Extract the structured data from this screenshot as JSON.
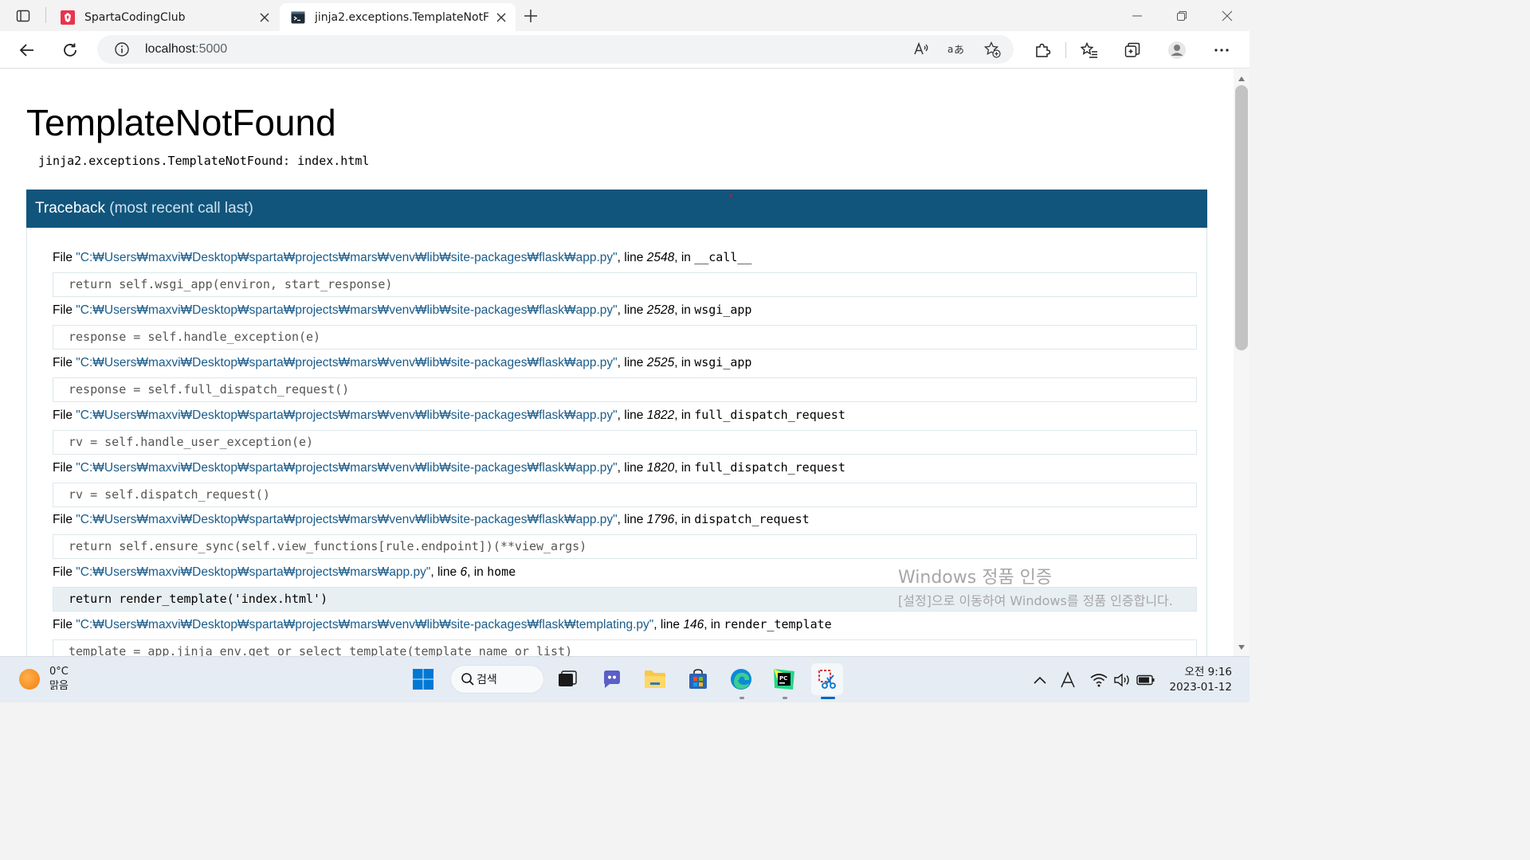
{
  "browser": {
    "tabs": [
      {
        "title": "SpartaCodingClub",
        "active": false
      },
      {
        "title": "jinja2.exceptions.TemplateNotFound",
        "active": true
      }
    ],
    "address": {
      "host": "localhost",
      "port": ":5000"
    }
  },
  "page": {
    "error_title": "TemplateNotFound",
    "error_message": "jinja2.exceptions.TemplateNotFound: index.html",
    "traceback_label": "Traceback",
    "traceback_sub": "(most recent call last)",
    "file_word": "File",
    "line_word": "line",
    "in_word": "in",
    "frames": [
      {
        "file": "\"C:₩Users₩maxvi₩Desktop₩sparta₩projects₩mars₩venv₩lib₩site-packages₩flask₩app.py\"",
        "line": "2548",
        "func": "__call__",
        "code": "return self.wsgi_app(environ, start_response)",
        "current": false
      },
      {
        "file": "\"C:₩Users₩maxvi₩Desktop₩sparta₩projects₩mars₩venv₩lib₩site-packages₩flask₩app.py\"",
        "line": "2528",
        "func": "wsgi_app",
        "code": "response = self.handle_exception(e)",
        "current": false
      },
      {
        "file": "\"C:₩Users₩maxvi₩Desktop₩sparta₩projects₩mars₩venv₩lib₩site-packages₩flask₩app.py\"",
        "line": "2525",
        "func": "wsgi_app",
        "code": "response = self.full_dispatch_request()",
        "current": false
      },
      {
        "file": "\"C:₩Users₩maxvi₩Desktop₩sparta₩projects₩mars₩venv₩lib₩site-packages₩flask₩app.py\"",
        "line": "1822",
        "func": "full_dispatch_request",
        "code": "rv = self.handle_user_exception(e)",
        "current": false
      },
      {
        "file": "\"C:₩Users₩maxvi₩Desktop₩sparta₩projects₩mars₩venv₩lib₩site-packages₩flask₩app.py\"",
        "line": "1820",
        "func": "full_dispatch_request",
        "code": "rv = self.dispatch_request()",
        "current": false
      },
      {
        "file": "\"C:₩Users₩maxvi₩Desktop₩sparta₩projects₩mars₩venv₩lib₩site-packages₩flask₩app.py\"",
        "line": "1796",
        "func": "dispatch_request",
        "code": "return self.ensure_sync(self.view_functions[rule.endpoint])(**view_args)",
        "current": false
      },
      {
        "file": "\"C:₩Users₩maxvi₩Desktop₩sparta₩projects₩mars₩app.py\"",
        "line": "6",
        "func": "home",
        "code": "return render_template('index.html')",
        "current": true
      },
      {
        "file": "\"C:₩Users₩maxvi₩Desktop₩sparta₩projects₩mars₩venv₩lib₩site-packages₩flask₩templating.py\"",
        "line": "146",
        "func": "render_template",
        "code": "template = app.jinja_env.get_or_select_template(template_name_or_list)",
        "current": false
      }
    ]
  },
  "watermark": {
    "line1": "Windows 정품 인증",
    "line2": "[설정]으로 이동하여 Windows를 정품 인증합니다."
  },
  "taskbar": {
    "weather_temp": "0°C",
    "weather_desc": "맑음",
    "search_label": "검색",
    "time": "오전 9:16",
    "date": "2023-01-12"
  },
  "colors": {
    "traceback_header": "#11557c",
    "file_link": "#1b5c8a",
    "current_line_bg": "#e8eff2"
  }
}
